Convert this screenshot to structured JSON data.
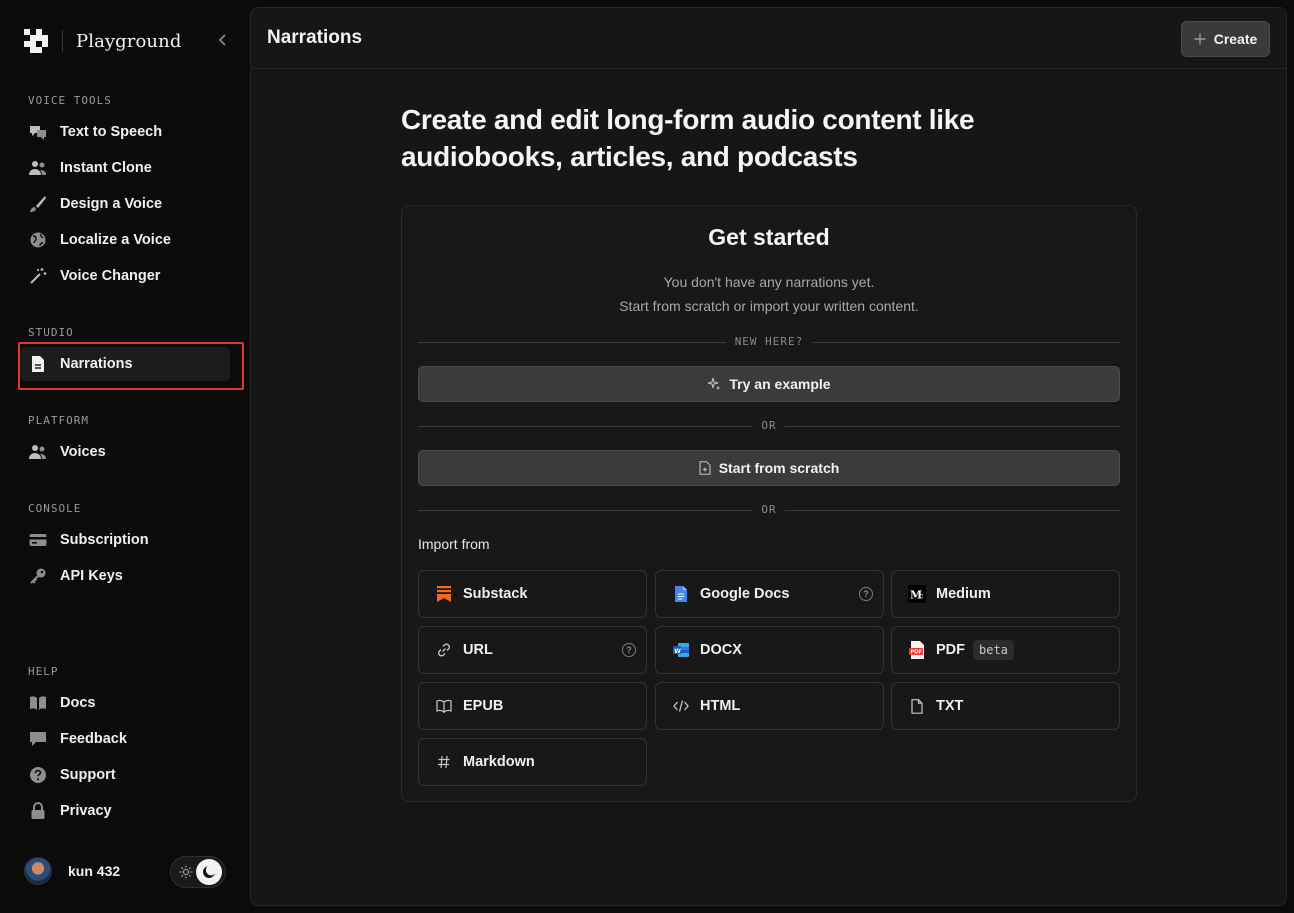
{
  "brand": {
    "name": "Playground"
  },
  "sidebar": {
    "sections": [
      {
        "title": "VOICE TOOLS",
        "items": [
          {
            "label": "Text to Speech",
            "icon": "speech-bubbles-icon"
          },
          {
            "label": "Instant Clone",
            "icon": "users-icon"
          },
          {
            "label": "Design a Voice",
            "icon": "brush-icon"
          },
          {
            "label": "Localize a Voice",
            "icon": "globe-icon"
          },
          {
            "label": "Voice Changer",
            "icon": "magic-wand-icon"
          }
        ]
      },
      {
        "title": "STUDIO",
        "items": [
          {
            "label": "Narrations",
            "icon": "document-icon",
            "active": true
          }
        ]
      },
      {
        "title": "PLATFORM",
        "items": [
          {
            "label": "Voices",
            "icon": "users-icon"
          }
        ]
      },
      {
        "title": "CONSOLE",
        "items": [
          {
            "label": "Subscription",
            "icon": "credit-card-icon"
          },
          {
            "label": "API Keys",
            "icon": "key-icon"
          }
        ]
      },
      {
        "title": "HELP",
        "items": [
          {
            "label": "Docs",
            "icon": "book-icon"
          },
          {
            "label": "Feedback",
            "icon": "chat-icon"
          },
          {
            "label": "Support",
            "icon": "question-icon"
          },
          {
            "label": "Privacy",
            "icon": "lock-icon"
          }
        ]
      }
    ],
    "user": {
      "name": "kun 432"
    }
  },
  "header": {
    "title": "Narrations",
    "create_label": "Create"
  },
  "main": {
    "headline": "Create and edit long-form audio content like audiobooks, articles, and podcasts",
    "card": {
      "title": "Get started",
      "subtitle_line1": "You don't have any narrations yet.",
      "subtitle_line2": "Start from scratch or import your written content.",
      "divider_new": "NEW HERE?",
      "try_example_label": "Try an example",
      "divider_or": "OR",
      "start_scratch_label": "Start from scratch",
      "import_label": "Import from",
      "sources": [
        {
          "label": "Substack",
          "icon": "substack-icon"
        },
        {
          "label": "Google Docs",
          "icon": "google-docs-icon",
          "help": "?"
        },
        {
          "label": "Medium",
          "icon": "medium-icon"
        },
        {
          "label": "URL",
          "icon": "link-icon",
          "help": "?"
        },
        {
          "label": "DOCX",
          "icon": "word-icon"
        },
        {
          "label": "PDF",
          "icon": "pdf-icon",
          "badge": "beta"
        },
        {
          "label": "EPUB",
          "icon": "open-book-icon"
        },
        {
          "label": "HTML",
          "icon": "code-icon"
        },
        {
          "label": "TXT",
          "icon": "file-icon"
        },
        {
          "label": "Markdown",
          "icon": "hash-icon"
        }
      ]
    }
  },
  "colors": {
    "highlight": "#e03a22",
    "substack": "#ff6719",
    "google_docs": "#4285f4",
    "pdf": "#e53935",
    "word": "#2b6cd6"
  }
}
